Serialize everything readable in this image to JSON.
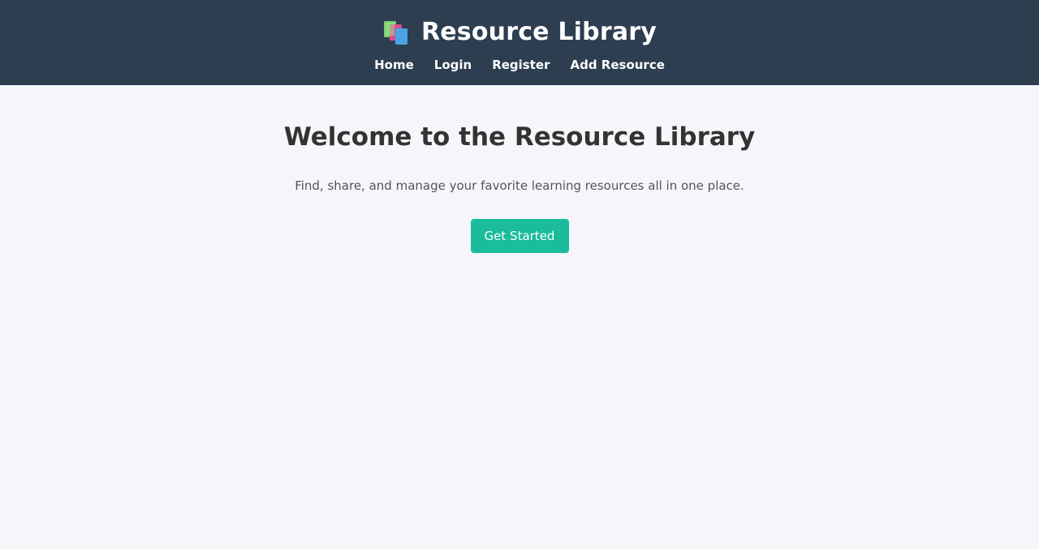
{
  "header": {
    "title": "Resource Library",
    "logo_icon": "books-icon",
    "background_color": "#2c3e50"
  },
  "nav": {
    "items": [
      {
        "label": "Home"
      },
      {
        "label": "Login"
      },
      {
        "label": "Register"
      },
      {
        "label": "Add Resource"
      }
    ]
  },
  "hero": {
    "title": "Welcome to the Resource Library",
    "subtitle": "Find, share, and manage your favorite learning resources all in one place.",
    "cta_label": "Get Started",
    "cta_color": "#1abc9c"
  },
  "page": {
    "background_color": "#f4f6fa"
  }
}
